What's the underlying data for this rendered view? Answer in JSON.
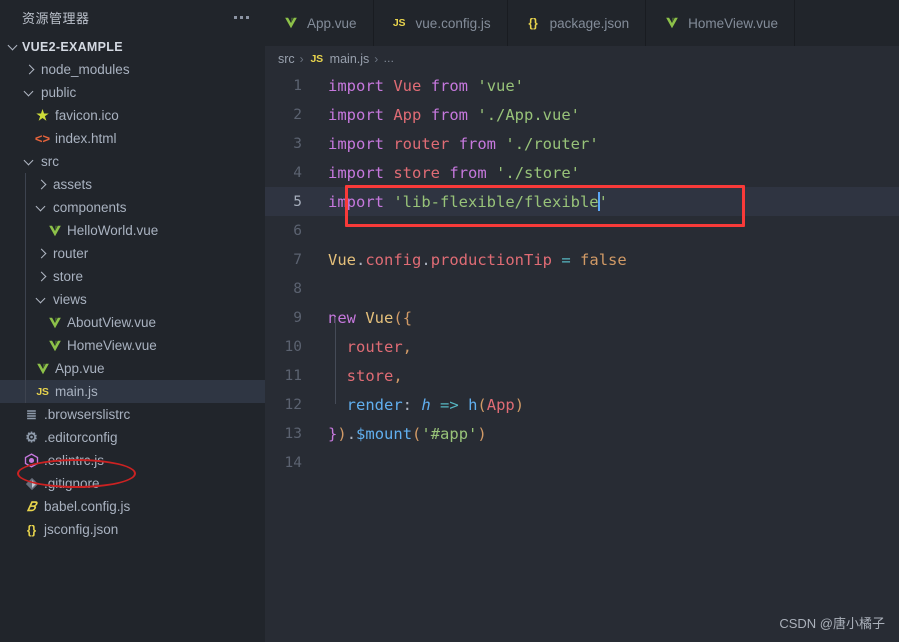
{
  "sidebar": {
    "title": "资源管理器",
    "more_icon": "ellipsis-icon",
    "root": {
      "label": "VUE2-EXAMPLE",
      "expanded": true
    },
    "items": [
      {
        "label": "node_modules",
        "type": "folder",
        "expanded": false,
        "depth": 1,
        "icon": "chevron-right-icon"
      },
      {
        "label": "public",
        "type": "folder",
        "expanded": true,
        "depth": 1,
        "icon": "chevron-down-icon"
      },
      {
        "label": "favicon.ico",
        "type": "file",
        "depth": 2,
        "icon": "star-icon"
      },
      {
        "label": "index.html",
        "type": "file",
        "depth": 2,
        "icon": "html-icon"
      },
      {
        "label": "src",
        "type": "folder",
        "expanded": true,
        "depth": 1,
        "icon": "chevron-down-icon"
      },
      {
        "label": "assets",
        "type": "folder",
        "expanded": false,
        "depth": 2,
        "icon": "chevron-right-icon"
      },
      {
        "label": "components",
        "type": "folder",
        "expanded": true,
        "depth": 2,
        "icon": "chevron-down-icon"
      },
      {
        "label": "HelloWorld.vue",
        "type": "file",
        "depth": 3,
        "icon": "vue-icon"
      },
      {
        "label": "router",
        "type": "folder",
        "expanded": false,
        "depth": 2,
        "icon": "chevron-right-icon"
      },
      {
        "label": "store",
        "type": "folder",
        "expanded": false,
        "depth": 2,
        "icon": "chevron-right-icon"
      },
      {
        "label": "views",
        "type": "folder",
        "expanded": true,
        "depth": 2,
        "icon": "chevron-down-icon"
      },
      {
        "label": "AboutView.vue",
        "type": "file",
        "depth": 3,
        "icon": "vue-icon"
      },
      {
        "label": "HomeView.vue",
        "type": "file",
        "depth": 3,
        "icon": "vue-icon"
      },
      {
        "label": "App.vue",
        "type": "file",
        "depth": 2,
        "icon": "vue-icon"
      },
      {
        "label": "main.js",
        "type": "file",
        "depth": 2,
        "icon": "js-icon",
        "selected": true,
        "annotated": true
      },
      {
        "label": ".browserslistrc",
        "type": "file",
        "depth": 1,
        "icon": "lines-icon"
      },
      {
        "label": ".editorconfig",
        "type": "file",
        "depth": 1,
        "icon": "gear-icon"
      },
      {
        "label": ".eslintrc.js",
        "type": "file",
        "depth": 1,
        "icon": "eslint-icon"
      },
      {
        "label": ".gitignore",
        "type": "file",
        "depth": 1,
        "icon": "git-icon"
      },
      {
        "label": "babel.config.js",
        "type": "file",
        "depth": 1,
        "icon": "babel-icon"
      },
      {
        "label": "jsconfig.json",
        "type": "file",
        "depth": 1,
        "icon": "json-icon"
      }
    ]
  },
  "tabs": [
    {
      "label": "App.vue",
      "icon": "vue-icon",
      "active": false
    },
    {
      "label": "vue.config.js",
      "icon": "js-icon",
      "active": false
    },
    {
      "label": "package.json",
      "icon": "json-icon",
      "active": false
    },
    {
      "label": "HomeView.vue",
      "icon": "vue-icon",
      "active": false
    }
  ],
  "breadcrumb": {
    "folder": "src",
    "sep1": "›",
    "file_icon": "js-icon",
    "file": "main.js",
    "sep2": "›",
    "dots": "…"
  },
  "editor": {
    "active_line": 5,
    "lines": [
      {
        "n": "1",
        "text": "import Vue from 'vue'"
      },
      {
        "n": "2",
        "text": "import App from './App.vue'"
      },
      {
        "n": "3",
        "text": "import router from './router'"
      },
      {
        "n": "4",
        "text": "import store from './store'"
      },
      {
        "n": "5",
        "text": "import 'lib-flexible/flexible'"
      },
      {
        "n": "6",
        "text": ""
      },
      {
        "n": "7",
        "text": "Vue.config.productionTip = false"
      },
      {
        "n": "8",
        "text": ""
      },
      {
        "n": "9",
        "text": "new Vue({"
      },
      {
        "n": "10",
        "text": "  router,"
      },
      {
        "n": "11",
        "text": "  store,"
      },
      {
        "n": "12",
        "text": "  render: h => h(App)"
      },
      {
        "n": "13",
        "text": "}).$mount('#app')"
      },
      {
        "n": "14",
        "text": ""
      }
    ]
  },
  "annotations": {
    "rect_color": "#f93a39",
    "ellipse_color": "#cc2222"
  },
  "watermark": "CSDN @唐小橘子",
  "theme": {
    "sidebar_bg": "#21252b",
    "editor_bg": "#282c34",
    "selected_bg": "#2f3643",
    "keyword": "#c678dd",
    "string": "#98c379",
    "variable": "#e06c75",
    "function": "#61afef",
    "class": "#e5c07b",
    "operator": "#56b6c2",
    "cursor": "#5ba7f7"
  }
}
